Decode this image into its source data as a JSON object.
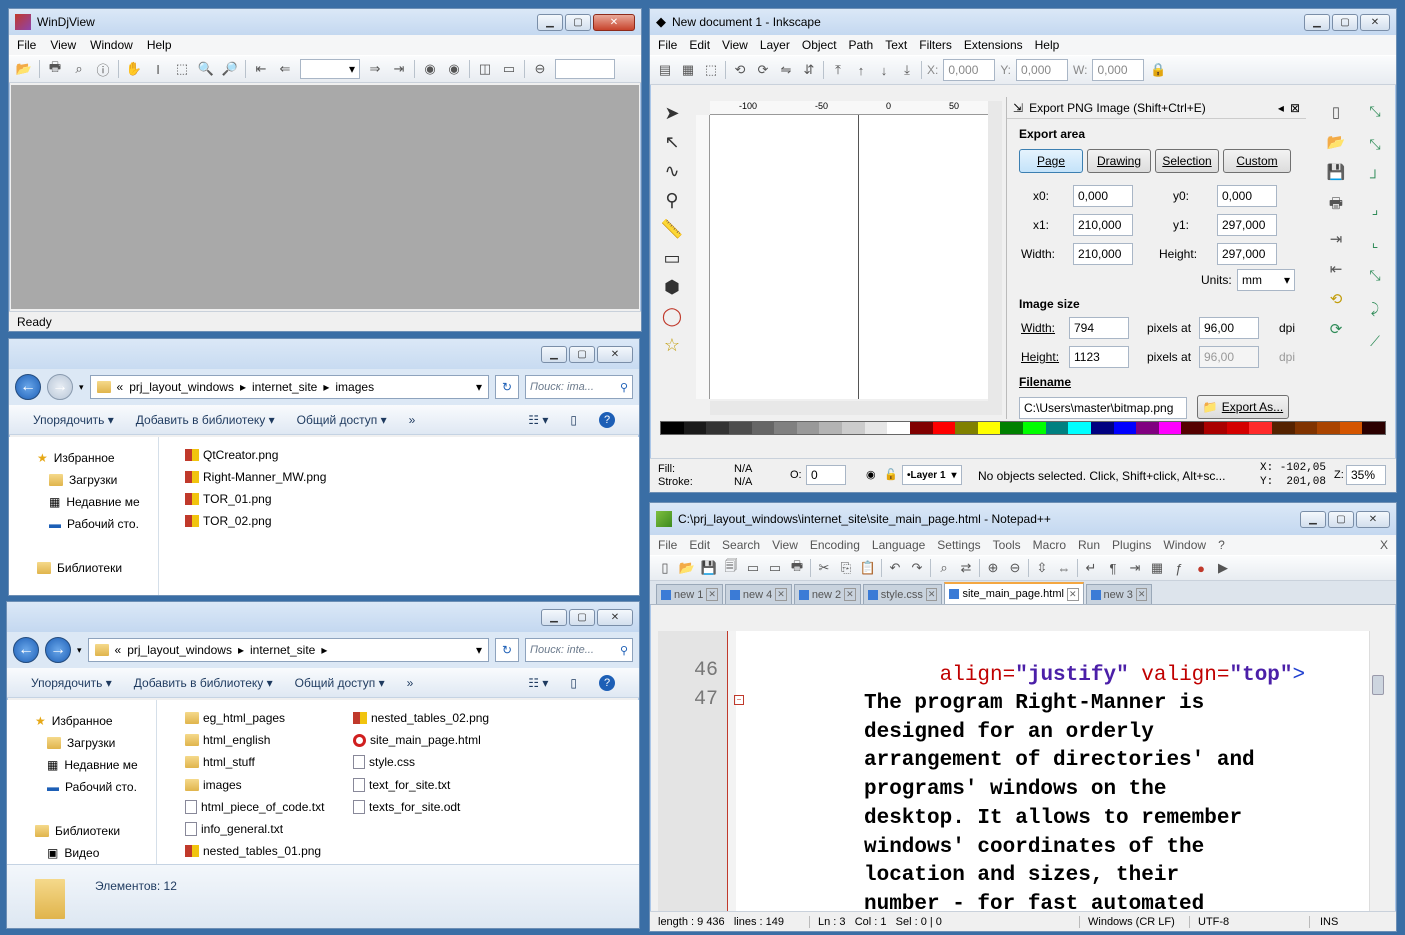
{
  "windjview": {
    "title": "WinDjView",
    "menu": [
      "File",
      "View",
      "Window",
      "Help"
    ],
    "status": "Ready"
  },
  "explorer1": {
    "breadcrumb": [
      "«",
      "prj_layout_windows",
      "internet_site",
      "images"
    ],
    "search_placeholder": "Поиск: ima...",
    "commands": [
      "Упорядочить ▾",
      "Добавить в библиотеку ▾",
      "Общий доступ ▾",
      "»"
    ],
    "nav": [
      "Избранное",
      "Загрузки",
      "Недавние ме",
      "Рабочий сто.",
      "Библиотеки"
    ],
    "files": [
      "QtCreator.png",
      "Right-Manner_MW.png",
      "TOR_01.png",
      "TOR_02.png"
    ]
  },
  "explorer2": {
    "breadcrumb": [
      "«",
      "prj_layout_windows",
      "internet_site"
    ],
    "search_placeholder": "Поиск: inte...",
    "commands": [
      "Упорядочить ▾",
      "Добавить в библиотеку ▾",
      "Общий доступ ▾",
      "»"
    ],
    "nav": [
      "Избранное",
      "Загрузки",
      "Недавние ме",
      "Рабочий сто.",
      "Библиотеки",
      "Видео"
    ],
    "files_col1": [
      "eg_html_pages",
      "html_english",
      "html_stuff",
      "images",
      "html_piece_of_code.txt",
      "info_general.txt",
      "nested_tables_01.png"
    ],
    "files_col2": [
      "nested_tables_02.png",
      "site_main_page.html",
      "style.css",
      "text_for_site.txt",
      "texts_for_site.odt"
    ],
    "status": "Элементов: 12"
  },
  "inkscape": {
    "title": "New document 1 - Inkscape",
    "menu": [
      "File",
      "Edit",
      "View",
      "Layer",
      "Object",
      "Path",
      "Text",
      "Filters",
      "Extensions",
      "Help"
    ],
    "toolbar": {
      "x_label": "X:",
      "x_value": "0,000",
      "y_label": "Y:",
      "y_value": "0,000",
      "w_label": "W:",
      "w_value": "0,000"
    },
    "ruler": [
      "-100",
      "-50",
      "0",
      "50"
    ],
    "export": {
      "title": "Export PNG Image (Shift+Ctrl+E)",
      "export_area": "Export area",
      "area_buttons": [
        "Page",
        "Drawing",
        "Selection",
        "Custom"
      ],
      "x0_label": "x0:",
      "x0": "0,000",
      "y0_label": "y0:",
      "y0": "0,000",
      "x1_label": "x1:",
      "x1": "210,000",
      "y1_label": "y1:",
      "y1": "297,000",
      "width_label": "Width:",
      "width": "210,000",
      "height_label": "Height:",
      "height": "297,000",
      "units_label": "Units:",
      "units": "mm",
      "image_size": "Image size",
      "px_width_label": "Width:",
      "px_width": "794",
      "px_height_label": "Height:",
      "px_height": "1123",
      "pixels_at": "pixels at",
      "dpi1": "96,00",
      "dpi2": "96,00",
      "dpi_label": "dpi",
      "filename_label": "Filename",
      "filename": "C:\\Users\\master\\bitmap.png",
      "export_as": "Export As..."
    },
    "status": {
      "fill_label": "Fill:",
      "fill": "N/A",
      "stroke_label": "Stroke:",
      "stroke": "N/A",
      "opacity_label": "O:",
      "opacity": "0",
      "layer": "•Layer 1",
      "message": "No objects selected. Click, Shift+click, Alt+sc...",
      "x_coord": "X: -102,05",
      "y_coord": "Y:  201,08",
      "zoom_label": "Z:",
      "zoom": "35%"
    },
    "palette": [
      "#000000",
      "#1a1a1a",
      "#333333",
      "#4d4d4d",
      "#666666",
      "#808080",
      "#999999",
      "#b3b3b3",
      "#cccccc",
      "#e6e6e6",
      "#ffffff",
      "#800000",
      "#ff0000",
      "#808000",
      "#ffff00",
      "#008000",
      "#00ff00",
      "#008080",
      "#00ffff",
      "#000080",
      "#0000ff",
      "#800080",
      "#ff00ff",
      "#550000",
      "#aa0000",
      "#d40000",
      "#ff2a2a",
      "#552200",
      "#803300",
      "#aa4400",
      "#d45500",
      "#2b0000"
    ]
  },
  "notepad": {
    "title": "C:\\prj_layout_windows\\internet_site\\site_main_page.html - Notepad++",
    "menu": [
      "File",
      "Edit",
      "Search",
      "View",
      "Encoding",
      "Language",
      "Settings",
      "Tools",
      "Macro",
      "Run",
      "Plugins",
      "Window",
      "?"
    ],
    "close_x": "X",
    "tabs": [
      "new 1",
      "new 4",
      "new 2",
      "style.css",
      "site_main_page.html",
      "new 3"
    ],
    "active_tab": 4,
    "line_numbers": [
      "",
      "46",
      "47"
    ],
    "code_first": {
      "attr1": "align=",
      "val1": "\"justify\"",
      "attr2": " valign=",
      "val2": "\"top\"",
      "close": ">"
    },
    "code_lines": [
      "The program Right-Manner is",
      "designed for an orderly",
      "arrangement of directories' and",
      "programs' windows on the",
      "desktop. It allows to remember",
      "windows' coordinates of the",
      "location and sizes, their",
      "number - for fast automated"
    ],
    "status": [
      "length : 9 436   lines : 149",
      "Ln : 3   Col : 1   Sel : 0 | 0",
      "Windows (CR LF)",
      "UTF-8",
      "INS"
    ]
  }
}
